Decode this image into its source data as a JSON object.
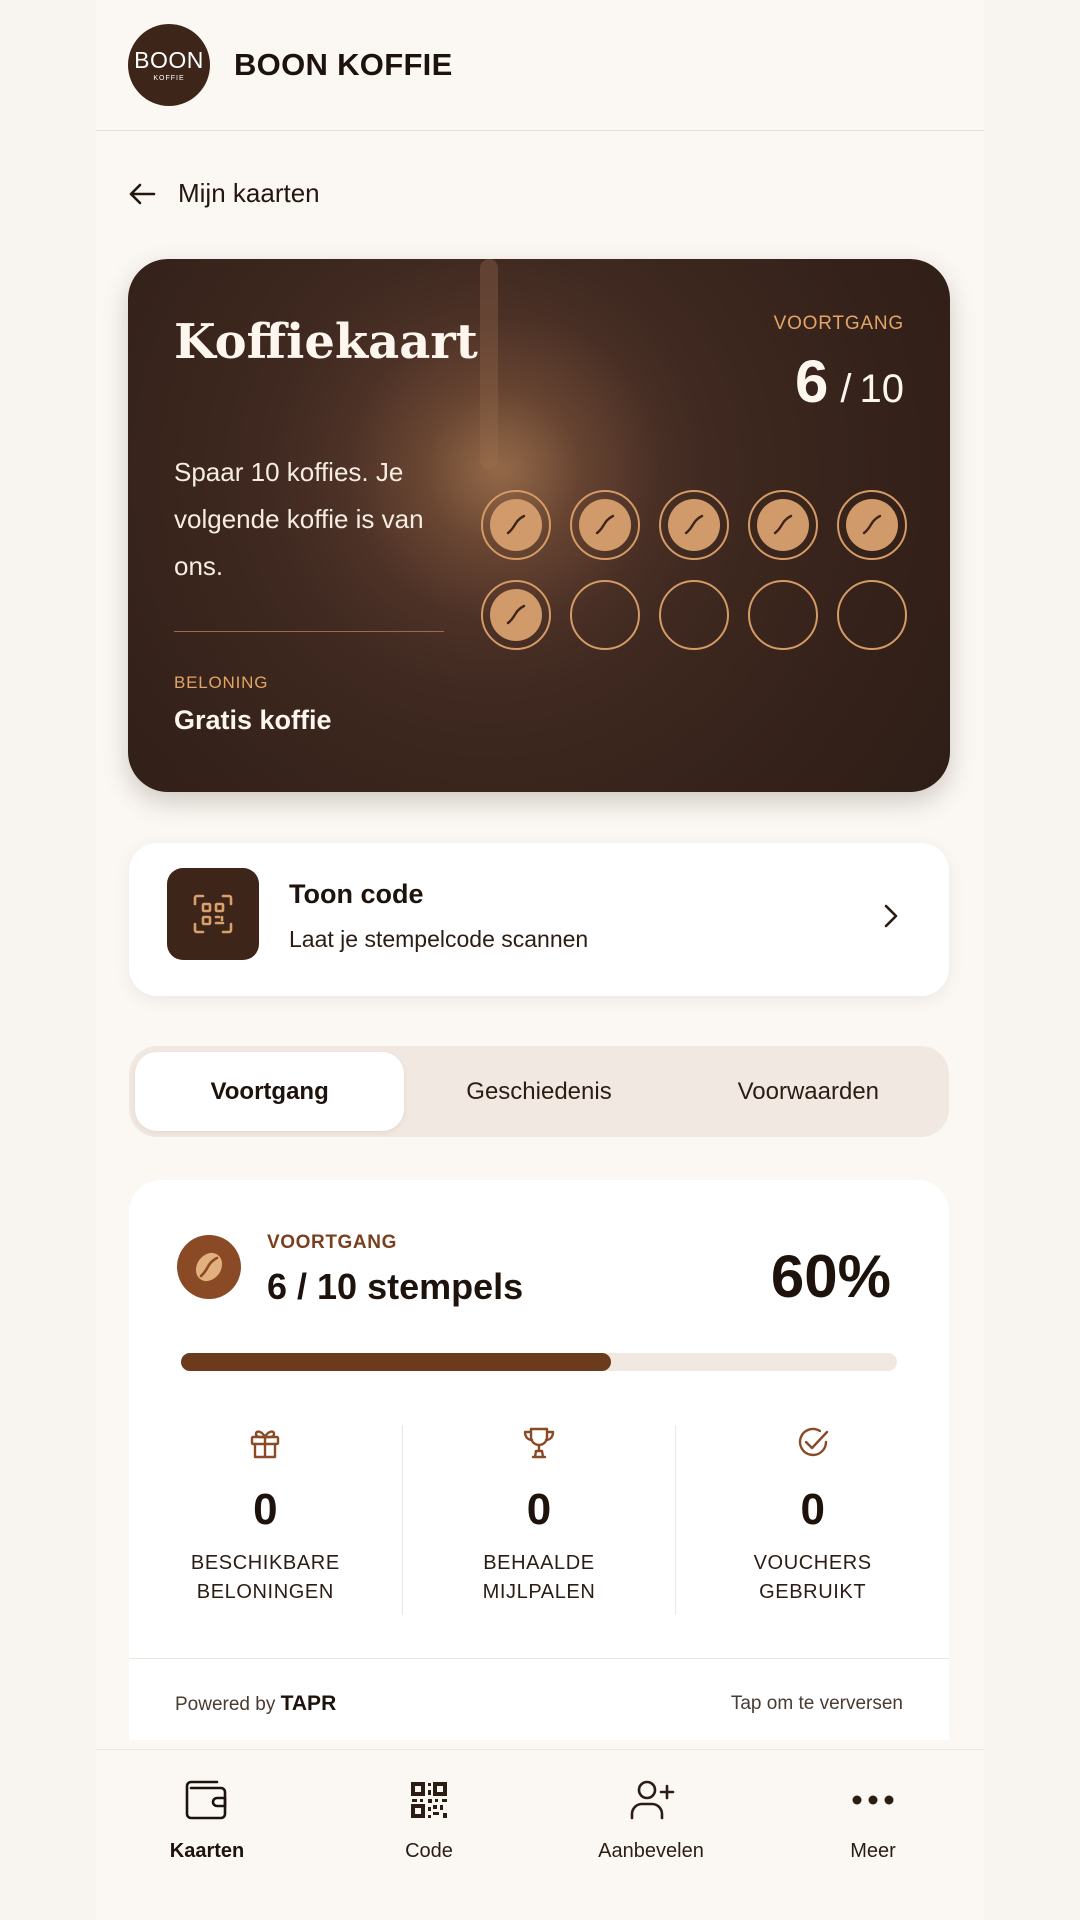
{
  "header": {
    "logo_line1": "BOON",
    "logo_line2": "KOFFIE",
    "brand": "BOON KOFFIE"
  },
  "back": {
    "label": "Mijn kaarten"
  },
  "card": {
    "title": "Koffiekaart",
    "description": "Spaar 10 koffies. Je volgende koffie is van ons.",
    "progress_label": "VOORTGANG",
    "progress_current": "6",
    "progress_sep": "/",
    "progress_total": "10",
    "stamps_filled": 6,
    "stamps_total": 10,
    "reward_label": "BELONING",
    "reward_value": "Gratis koffie"
  },
  "code": {
    "title": "Toon code",
    "subtitle": "Laat je stempelcode scannen",
    "icon": "qr-scan-icon"
  },
  "tabs": [
    {
      "label": "Voortgang",
      "active": true
    },
    {
      "label": "Geschiedenis",
      "active": false
    },
    {
      "label": "Voorwaarden",
      "active": false
    }
  ],
  "progress": {
    "label": "VOORTGANG",
    "value": "6 / 10 stempels",
    "percent_text": "60%",
    "fraction": 0.6,
    "stats": [
      {
        "icon": "gift-icon",
        "value": "0",
        "label_line1": "BESCHIKBARE",
        "label_line2": "BELONINGEN"
      },
      {
        "icon": "trophy-icon",
        "value": "0",
        "label_line1": "BEHAALDE",
        "label_line2": "MIJLPALEN"
      },
      {
        "icon": "check-circle-icon",
        "value": "0",
        "label_line1": "VOUCHERS",
        "label_line2": "GEBRUIKT"
      }
    ],
    "powered_by": "Powered by",
    "powered_brand": "TAPR",
    "refresh": "Tap om te verversen"
  },
  "nav": [
    {
      "label": "Kaarten",
      "icon": "wallet-icon",
      "active": true
    },
    {
      "label": "Code",
      "icon": "qr-code-icon",
      "active": false
    },
    {
      "label": "Aanbevelen",
      "icon": "add-user-icon",
      "active": false
    },
    {
      "label": "Meer",
      "icon": "more-icon",
      "active": false
    }
  ],
  "colors": {
    "brand_dark": "#3e2519",
    "accent": "#e3a466",
    "progress_fill": "#6c3a1d",
    "background": "#fbf8f4"
  }
}
